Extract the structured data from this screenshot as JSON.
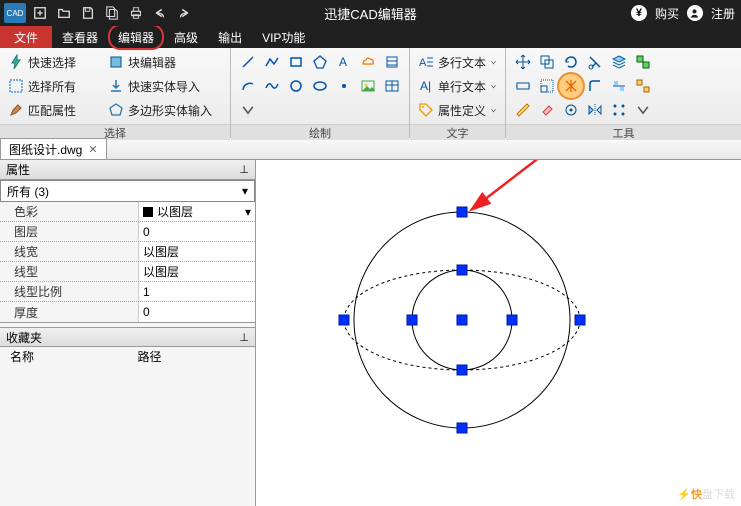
{
  "titlebar": {
    "app_abbrev": "CAD",
    "title": "迅捷CAD编辑器",
    "buy": "购买",
    "register": "注册"
  },
  "menu": {
    "file": "文件",
    "viewer": "查看器",
    "editor": "编辑器",
    "advanced": "高级",
    "output": "输出",
    "vip": "VIP功能"
  },
  "ribbon": {
    "select": {
      "label": "选择",
      "quick_select": "快速选择",
      "select_all": "选择所有",
      "match_props": "匹配属性",
      "block_editor": "块编辑器",
      "quick_import": "快速实体导入",
      "polygon_import": "多边形实体输入"
    },
    "draw": {
      "label": "绘制"
    },
    "text": {
      "label": "文字",
      "mtext": "多行文本",
      "stext": "单行文本",
      "attrdef": "属性定义"
    },
    "tools": {
      "label": "工具"
    }
  },
  "filetab": {
    "name": "图纸设计.dwg"
  },
  "props": {
    "header": "属性",
    "selector": "所有 (3)",
    "rows": {
      "color": {
        "label": "色彩",
        "value": "以图层"
      },
      "layer": {
        "label": "图层",
        "value": "0"
      },
      "lineweight": {
        "label": "线宽",
        "value": "以图层"
      },
      "linetype": {
        "label": "线型",
        "value": "以图层"
      },
      "ltscale": {
        "label": "线型比例",
        "value": "1"
      },
      "thickness": {
        "label": "厚度",
        "value": "0"
      }
    }
  },
  "favorites": {
    "header": "收藏夹",
    "col_name": "名称",
    "col_path": "路径"
  },
  "watermark": {
    "brand": "快",
    "text": "盘下载"
  }
}
